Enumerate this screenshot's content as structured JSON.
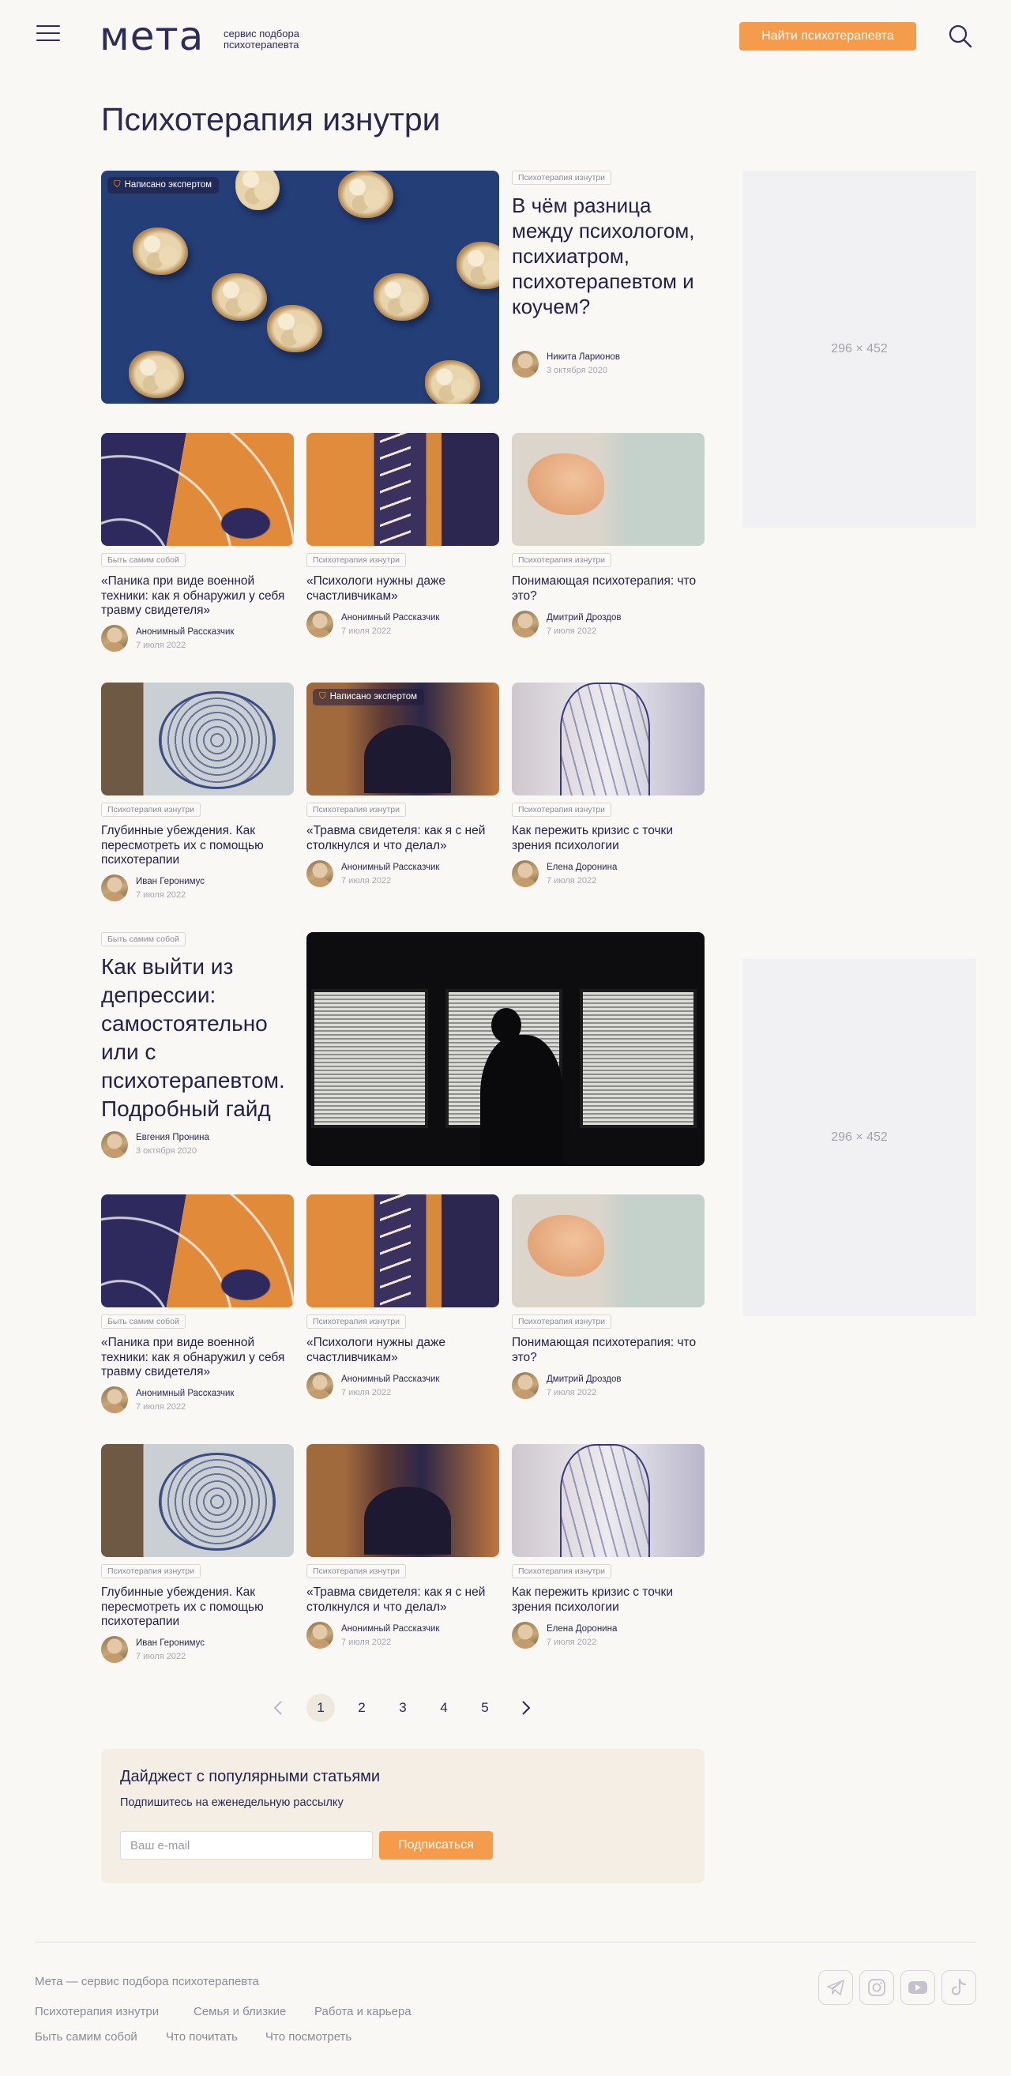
{
  "header": {
    "logo": "мета",
    "logo_sub_line1": "сервис подбора",
    "logo_sub_line2": "психотерапевта",
    "find_button": "Найти психотерапевта",
    "menu_icon": "hamburger-icon",
    "search_icon": "search-icon"
  },
  "page_title": "Психотерапия изнутри",
  "featured": {
    "badge": "Написано экспертом",
    "tag": "Психотерапия изнутри",
    "title": "В чём разница между психологом, психиатром, психотерапевтом и коучем?",
    "author": "Никита Ларионов",
    "date": "3 октября 2020"
  },
  "ads": [
    "296 × 452",
    "296 × 452"
  ],
  "grid1": [
    {
      "tag": "Быть самим собой",
      "title": "«Паника при виде военной техники: как я обнаружил у себя травму свидетеля»",
      "author": "Анонимный Рассказчик",
      "date": "7 июля 2022"
    },
    {
      "tag": "Психотерапия изнутри",
      "title": "«Психологи нужны даже счастливчикам»",
      "author": "Анонимный Рассказчик",
      "date": "7 июля 2022"
    },
    {
      "tag": "Психотерапия изнутри",
      "title": "Понимающая психотерапия: что это?",
      "author": "Дмитрий Дроздов",
      "date": "7 июля 2022"
    }
  ],
  "grid2": [
    {
      "tag": "Психотерапия изнутри",
      "title": "Глубинные убеждения. Как пересмотреть их с помощью психотерапии",
      "author": "Иван Геронимус",
      "date": "7 июля 2022"
    },
    {
      "tag": "Психотерапия изнутри",
      "title": "«Травма свидетеля: как я с ней столкнулся и что делал»",
      "author": "Анонимный Рассказчик",
      "date": "7 июля 2022",
      "badge": "Написано экспертом"
    },
    {
      "tag": "Психотерапия изнутри",
      "title": "Как пережить кризис с точки зрения психологии",
      "author": "Елена Доронина",
      "date": "7 июля 2022"
    }
  ],
  "featured2": {
    "tag": "Быть самим собой",
    "title": "Как выйти из депрессии: самостоятельно или с психотерапевтом. Подробный гайд",
    "author": "Евгения Пронина",
    "date": "3 октября 2020"
  },
  "grid3": [
    {
      "tag": "Быть самим собой",
      "title": "«Паника при виде военной техники: как я обнаружил у себя травму свидетеля»",
      "author": "Анонимный Рассказчик",
      "date": "7 июля 2022"
    },
    {
      "tag": "Психотерапия изнутри",
      "title": "«Психологи нужны даже счастливчикам»",
      "author": "Анонимный Рассказчик",
      "date": "7 июля 2022"
    },
    {
      "tag": "Психотерапия изнутри",
      "title": "Понимающая психотерапия: что это?",
      "author": "Дмитрий Дроздов",
      "date": "7 июля 2022"
    }
  ],
  "grid4": [
    {
      "tag": "Психотерапия изнутри",
      "title": "Глубинные убеждения. Как пересмотреть их с помощью психотерапии",
      "author": "Иван Геронимус",
      "date": "7 июля 2022"
    },
    {
      "tag": "Психотерапия изнутри",
      "title": "«Травма свидетеля: как я с ней столкнулся и что делал»",
      "author": "Анонимный Рассказчик",
      "date": "7 июля 2022"
    },
    {
      "tag": "Психотерапия изнутри",
      "title": "Как пережить кризис с точки зрения психологии",
      "author": "Елена Доронина",
      "date": "7 июля 2022"
    }
  ],
  "pagination": {
    "pages": [
      "1",
      "2",
      "3",
      "4",
      "5"
    ],
    "current": "1",
    "prev_icon": "chevron-left-icon",
    "next_icon": "chevron-right-icon"
  },
  "digest": {
    "title": "Дайджест с популярными статьями",
    "subtitle": "Подпишитесь на еженедельную рассылку",
    "email_placeholder": "Ваш e-mail",
    "button": "Подписаться"
  },
  "footer": {
    "brand": "Мета — сервис подбора психотерапевта",
    "links_row1": [
      "Психотерапия изнутри",
      "Семья и близкие",
      "Работа и карьера"
    ],
    "links_row2": [
      "Быть самим собой",
      "Что почитать",
      "Что посмотреть"
    ],
    "social": [
      "telegram-icon",
      "instagram-icon",
      "youtube-icon",
      "tiktok-icon"
    ]
  },
  "colors": {
    "accent": "#f59b4c",
    "brand": "#2d2b5a",
    "background": "#faf8f5"
  }
}
